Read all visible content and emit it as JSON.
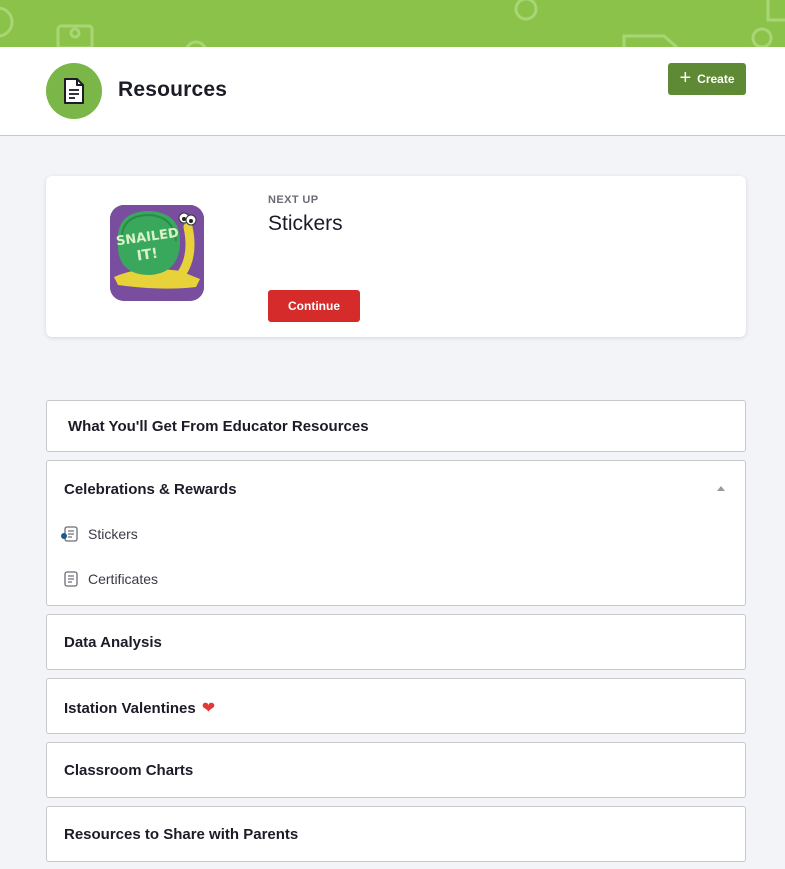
{
  "header": {
    "title": "Resources",
    "icon": "document-icon",
    "create_label": "Create",
    "accent": "#7ab648",
    "banner_color": "#8bc34a"
  },
  "next_up": {
    "label": "NEXT UP",
    "title": "Stickers",
    "continue_label": "Continue",
    "thumbnail_text": "SNAILED IT!",
    "button_color": "#d62b2b"
  },
  "sections": [
    {
      "title": "What You'll Get From Educator Resources",
      "expanded": false
    },
    {
      "title": "Celebrations & Rewards",
      "expanded": true,
      "items": [
        {
          "label": "Stickers",
          "current": true
        },
        {
          "label": "Certificates",
          "current": false
        }
      ]
    },
    {
      "title": "Data Analysis",
      "expanded": false
    },
    {
      "title": "Istation Valentines",
      "expanded": false,
      "emoji": "❤"
    },
    {
      "title": "Classroom Charts",
      "expanded": false
    },
    {
      "title": "Resources to Share with Parents",
      "expanded": false
    }
  ]
}
